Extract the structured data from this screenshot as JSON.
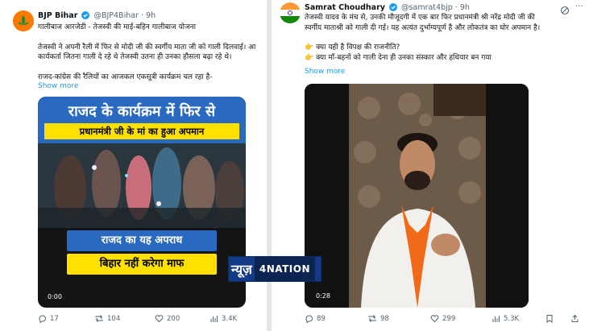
{
  "left_tweet": {
    "author": "BJP Bihar",
    "handle": "@BJP4Bihar",
    "separator": "·",
    "time": "9h",
    "line1": "गालीबाज आरजेडी - तेजस्वी की माई-बहिन गालीबाज योजना",
    "line2": "तेजस्वी ने अपनी रैली में फिर से मोदी जी की स्वर्गीय माता जी को गाली दिलवाई। आ",
    "line3": "कार्यकर्ता जितना गाली दे रहे थे तेजस्वी उतना ही उनका हौसला बढ़ा रहे थे।",
    "line4": "राजद-कांग्रेस की रैलियों का आजकल एकसूत्री कार्यक्रम चल रहा है-",
    "show_more": "Show more",
    "video": {
      "banner_line1": "राजद के कार्यक्रम में फिर से",
      "banner_line2": "प्रधानमंत्री जी के मां का हुआ अपमान",
      "banner_line3": "राजद का यह अपराध",
      "banner_line4": "बिहार नहीं करेगा माफ",
      "timestamp": "0:00"
    },
    "stats": {
      "replies": "17",
      "reposts": "104",
      "likes": "200",
      "views": "3.4K"
    }
  },
  "right_tweet": {
    "author": "Samrat Choudhary",
    "handle": "@samrat4bjp",
    "separator": "·",
    "time": "9h",
    "line1": "तेजस्वी यादव के मंच से, उनकी मौजूदगी में एक बार फिर प्रधानमंत्री श्री नरेंद्र मोदी जी की",
    "line2": "स्वर्गीय माताश्री को गाली दी गई। यह अत्यंत दुर्भाग्यपूर्ण है और लोकतंत्र का घोर अपमान है।",
    "bullet1": "क्या यही है विपक्ष की राजनीति?",
    "bullet2": "क्या माँ-बहनों को गाली देना ही उनका संस्कार और हथियार बन गया",
    "show_more": "Show more",
    "video": {
      "timestamp": "0:28"
    },
    "stats": {
      "replies": "89",
      "reposts": "98",
      "likes": "299",
      "views": "5.3K"
    }
  },
  "watermark": {
    "part1": "न्यूज़",
    "part2": "4NATION"
  }
}
